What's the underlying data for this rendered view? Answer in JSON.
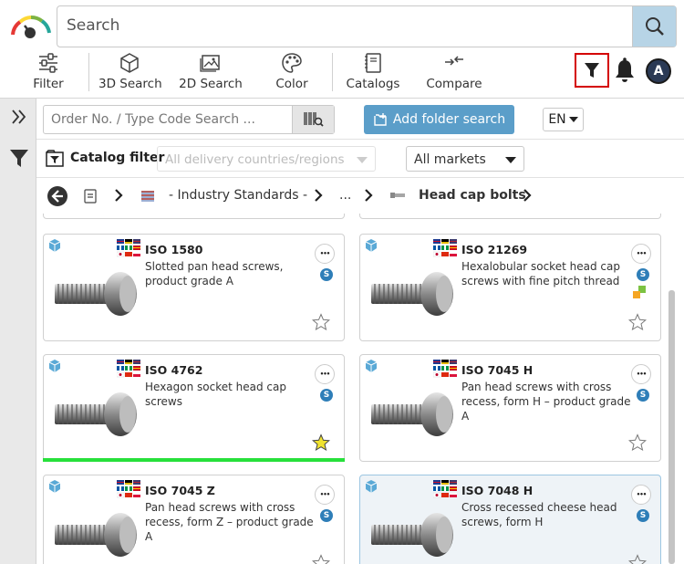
{
  "search": {
    "placeholder": "Search"
  },
  "toolbar": {
    "filter_label": "Filter",
    "search3d_label": "3D Search",
    "search2d_label": "2D Search",
    "color_label": "Color",
    "catalogs_label": "Catalogs",
    "compare_label": "Compare"
  },
  "user": {
    "avatar_initial": "A"
  },
  "ordno": {
    "placeholder": "Order No. / Type Code Search ..."
  },
  "add_folder_label": "Add folder search",
  "language": "EN",
  "catalog_filter": {
    "label": "Catalog filter",
    "country_placeholder": "All delivery countries/regions",
    "markets_value": "All markets"
  },
  "breadcrumb": {
    "industry_standards": "- Industry Standards -",
    "ellipsis": "...",
    "current": "Head cap bolts"
  },
  "cards": [
    {
      "title": "ISO 1580",
      "desc": "Slotted pan head screws, product grade A",
      "favorite": false,
      "selected": false
    },
    {
      "title": "ISO 21269",
      "desc": "Hexalobular socket head cap screws with fine pitch thread",
      "favorite": false,
      "selected": false
    },
    {
      "title": "ISO 4762",
      "desc": "Hexagon socket head cap screws",
      "favorite": true,
      "selected": false
    },
    {
      "title": "ISO 7045 H",
      "desc": "Pan head screws with cross recess, form H – product grade A",
      "favorite": false,
      "selected": false
    },
    {
      "title": "ISO 7045 Z",
      "desc": "Pan head screws with cross recess, form Z – product grade A",
      "favorite": false,
      "selected": false
    },
    {
      "title": "ISO 7048 H",
      "desc": "Cross recessed cheese head screws, form H",
      "favorite": false,
      "selected": true
    }
  ],
  "badge_letter": "S",
  "more_glyph": "•••",
  "colors": {
    "accent": "#5b9ec9",
    "highlight": "#d40000",
    "favorite": "#f0e330",
    "progress": "#27e03b"
  }
}
